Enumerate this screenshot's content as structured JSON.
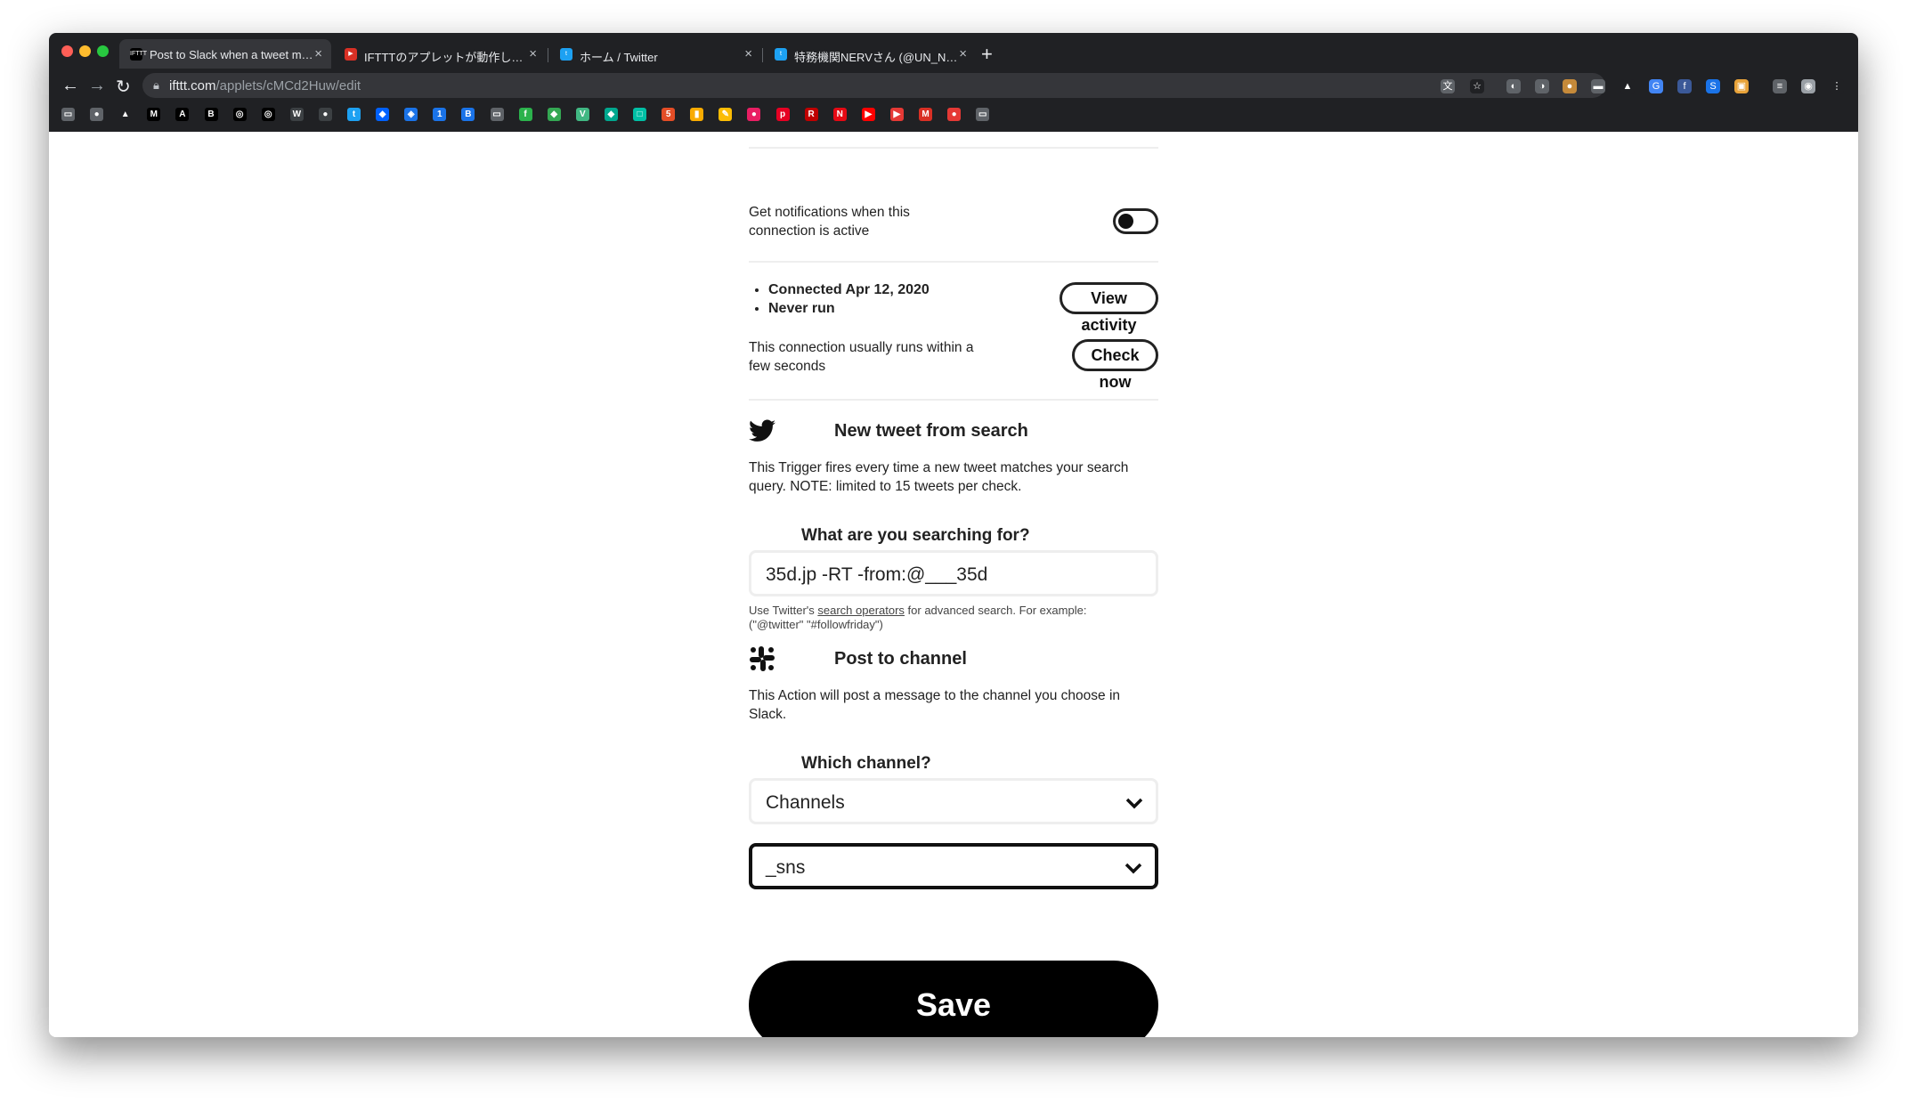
{
  "browser": {
    "tabs": [
      {
        "title": "Post to Slack when a tweet matches your search",
        "favicon_label": "IFTTT",
        "favicon_color": "#000000",
        "active": true
      },
      {
        "title": "IFTTTのアプレットが動作しない？",
        "favicon_label": "▶",
        "favicon_color": "#d93025",
        "active": false
      },
      {
        "title": "ホーム / Twitter",
        "favicon_label": "t",
        "favicon_color": "#1da1f2",
        "active": false
      },
      {
        "title": "特務機関NERVさん (@UN_NERV)",
        "favicon_label": "t",
        "favicon_color": "#1da1f2",
        "active": false
      }
    ],
    "new_tab": "+",
    "close_glyph": "×",
    "url_host": "ifttt.com",
    "url_path": "/applets/cMCd2Huw/edit",
    "back": "←",
    "forward": "→",
    "reload": "↻",
    "extensions": [
      {
        "icon": "translate-icon",
        "glyph": "文",
        "color": "#5f6368"
      },
      {
        "icon": "star-icon",
        "glyph": "☆",
        "color": "#202124"
      },
      {
        "icon": "ext-icon-1",
        "glyph": "◐",
        "color": "#5f6368"
      },
      {
        "icon": "ext-icon-2",
        "glyph": "◑",
        "color": "#5f6368"
      },
      {
        "icon": "cookie-icon",
        "glyph": "●",
        "color": "#c58a3a"
      },
      {
        "icon": "chat-icon",
        "glyph": "▬",
        "color": "#5f6368"
      },
      {
        "icon": "ext-icon-3",
        "glyph": "▲",
        "color": "#202124"
      },
      {
        "icon": "google-icon",
        "glyph": "G",
        "color": "#4285f4"
      },
      {
        "icon": "facebook-icon",
        "glyph": "f",
        "color": "#3b5998"
      },
      {
        "icon": "s-icon",
        "glyph": "S",
        "color": "#1a73e8"
      },
      {
        "icon": "ext-icon-4",
        "glyph": "▣",
        "color": "#e8a33a"
      },
      {
        "icon": "reading-list-icon",
        "glyph": "≡",
        "color": "#5f6368"
      },
      {
        "icon": "profile-icon",
        "glyph": "◉",
        "color": "#9aa0a6"
      },
      {
        "icon": "menu-icon",
        "glyph": "⋮",
        "color": "#202124"
      }
    ],
    "bookmarks": [
      {
        "icon": "folder-icon",
        "glyph": "▭",
        "color": "#5f6368"
      },
      {
        "icon": "profile-bm-icon",
        "glyph": "●",
        "color": "#5f6368"
      },
      {
        "icon": "triangle-bm-icon",
        "glyph": "▲",
        "color": "#202124"
      },
      {
        "icon": "medium-icon",
        "glyph": "M",
        "color": "#000000"
      },
      {
        "icon": "a-bm-icon",
        "glyph": "A",
        "color": "#000000"
      },
      {
        "icon": "hatena-icon",
        "glyph": "B",
        "color": "#000000"
      },
      {
        "icon": "github-icon",
        "glyph": "◎",
        "color": "#000000"
      },
      {
        "icon": "github-icon-2",
        "glyph": "◎",
        "color": "#000000"
      },
      {
        "icon": "w-bm-icon",
        "glyph": "W",
        "color": "#3c4043"
      },
      {
        "icon": "dot-bm-icon",
        "glyph": "●",
        "color": "#3c4043"
      },
      {
        "icon": "twitter-bm-icon",
        "glyph": "t",
        "color": "#1da1f2"
      },
      {
        "icon": "dropbox-icon",
        "glyph": "◆",
        "color": "#0061fe"
      },
      {
        "icon": "box-bm-icon",
        "glyph": "◈",
        "color": "#1a73e8"
      },
      {
        "icon": "calendar-icon",
        "glyph": "1",
        "color": "#1a73e8"
      },
      {
        "icon": "hatena-blue-icon",
        "glyph": "B",
        "color": "#1a73e8"
      },
      {
        "icon": "drive-bm-icon",
        "glyph": "▭",
        "color": "#5f6368"
      },
      {
        "icon": "feedly-icon",
        "glyph": "f",
        "color": "#2bb24c"
      },
      {
        "icon": "arrow-bm-icon",
        "glyph": "◆",
        "color": "#34a853"
      },
      {
        "icon": "vue-icon",
        "glyph": "V",
        "color": "#41b883"
      },
      {
        "icon": "diamond-bm-icon",
        "glyph": "◆",
        "color": "#00a88f"
      },
      {
        "icon": "sq-bm-icon",
        "glyph": "□",
        "color": "#00bfa5"
      },
      {
        "icon": "html-bm-icon",
        "glyph": "5",
        "color": "#e44d26"
      },
      {
        "icon": "analytics-icon",
        "glyph": "▮",
        "color": "#f9ab00"
      },
      {
        "icon": "pen-bm-icon",
        "glyph": "✎",
        "color": "#fbbc04"
      },
      {
        "icon": "mute-bm-icon",
        "glyph": "●",
        "color": "#e91e63"
      },
      {
        "icon": "pinterest-icon",
        "glyph": "p",
        "color": "#e60023"
      },
      {
        "icon": "rakuten-icon",
        "glyph": "R",
        "color": "#bf0000"
      },
      {
        "icon": "netflix-icon",
        "glyph": "N",
        "color": "#e50914"
      },
      {
        "icon": "youtube-icon",
        "glyph": "▶",
        "color": "#ff0000"
      },
      {
        "icon": "play-bm-icon",
        "glyph": "▶",
        "color": "#e53935"
      },
      {
        "icon": "gmail-icon",
        "glyph": "M",
        "color": "#d93025"
      },
      {
        "icon": "bm-icon-extra",
        "glyph": "●",
        "color": "#e53935"
      },
      {
        "icon": "folder-bm-icon",
        "glyph": "▭",
        "color": "#5f6368"
      }
    ]
  },
  "page": {
    "notifications_label": "Get notifications when this connection is active",
    "connected": "Connected Apr 12, 2020",
    "never_run": "Never run",
    "view_activity": "View activity",
    "runs_text": "This connection usually runs within a few seconds",
    "check_now": "Check now",
    "trigger_title": "New tweet from search",
    "trigger_desc": "This Trigger fires every time a new tweet matches your search query. NOTE: limited to 15 tweets per check.",
    "search_label": "What are you searching for?",
    "search_value": "35d.jp -RT -from:@___35d",
    "help_prefix": "Use Twitter's ",
    "help_link": "search operators",
    "help_suffix": " for advanced search. For example: (\"@twitter\" \"#followfriday\")",
    "action_title": "Post to channel",
    "action_desc": "This Action will post a message to the channel you choose in Slack.",
    "channel_label": "Which channel?",
    "channel_type": "Channels",
    "channel_value": "_sns",
    "save": "Save"
  }
}
